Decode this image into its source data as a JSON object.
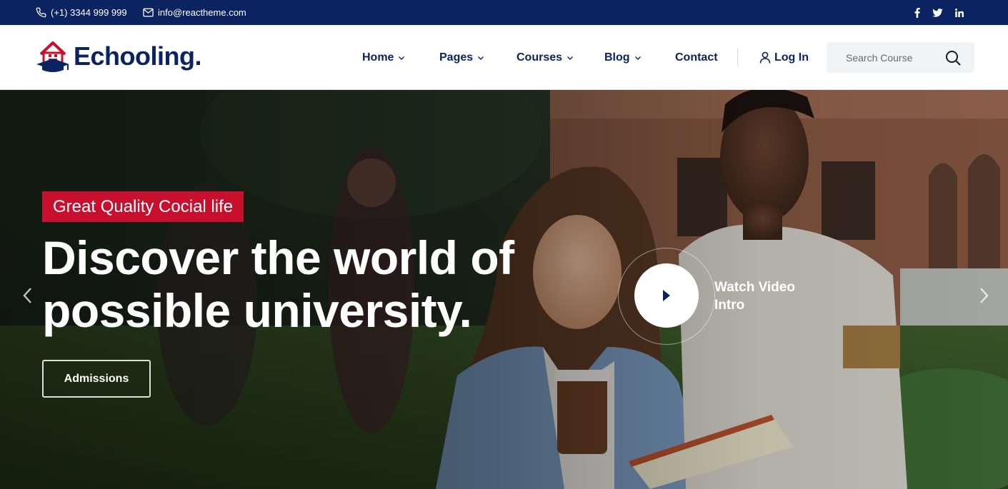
{
  "topbar": {
    "phone": "(+1) 3344 999 999",
    "email": "info@reactheme.com",
    "socials": [
      {
        "icon": "facebook-icon",
        "label": "f"
      },
      {
        "icon": "twitter-icon",
        "label": "t"
      },
      {
        "icon": "linkedin-icon",
        "label": "in"
      }
    ]
  },
  "header": {
    "logo_text": "Echooling",
    "logo_dot": ".",
    "nav": [
      {
        "label": "Home",
        "has_dropdown": true
      },
      {
        "label": "Pages",
        "has_dropdown": true
      },
      {
        "label": "Courses",
        "has_dropdown": true
      },
      {
        "label": "Blog",
        "has_dropdown": true
      },
      {
        "label": "Contact",
        "has_dropdown": false
      }
    ],
    "login_label": "Log In",
    "search_placeholder": "Search Course"
  },
  "hero": {
    "badge": "Great Quality Cocial life",
    "headline_line1": "Discover the world of",
    "headline_line2": "possible university.",
    "cta_label": "Admissions",
    "video_label": "Watch Video Intro"
  },
  "colors": {
    "brand_navy": "#0b2461",
    "accent_red": "#c8102e",
    "search_bg": "#f2f3f5"
  }
}
